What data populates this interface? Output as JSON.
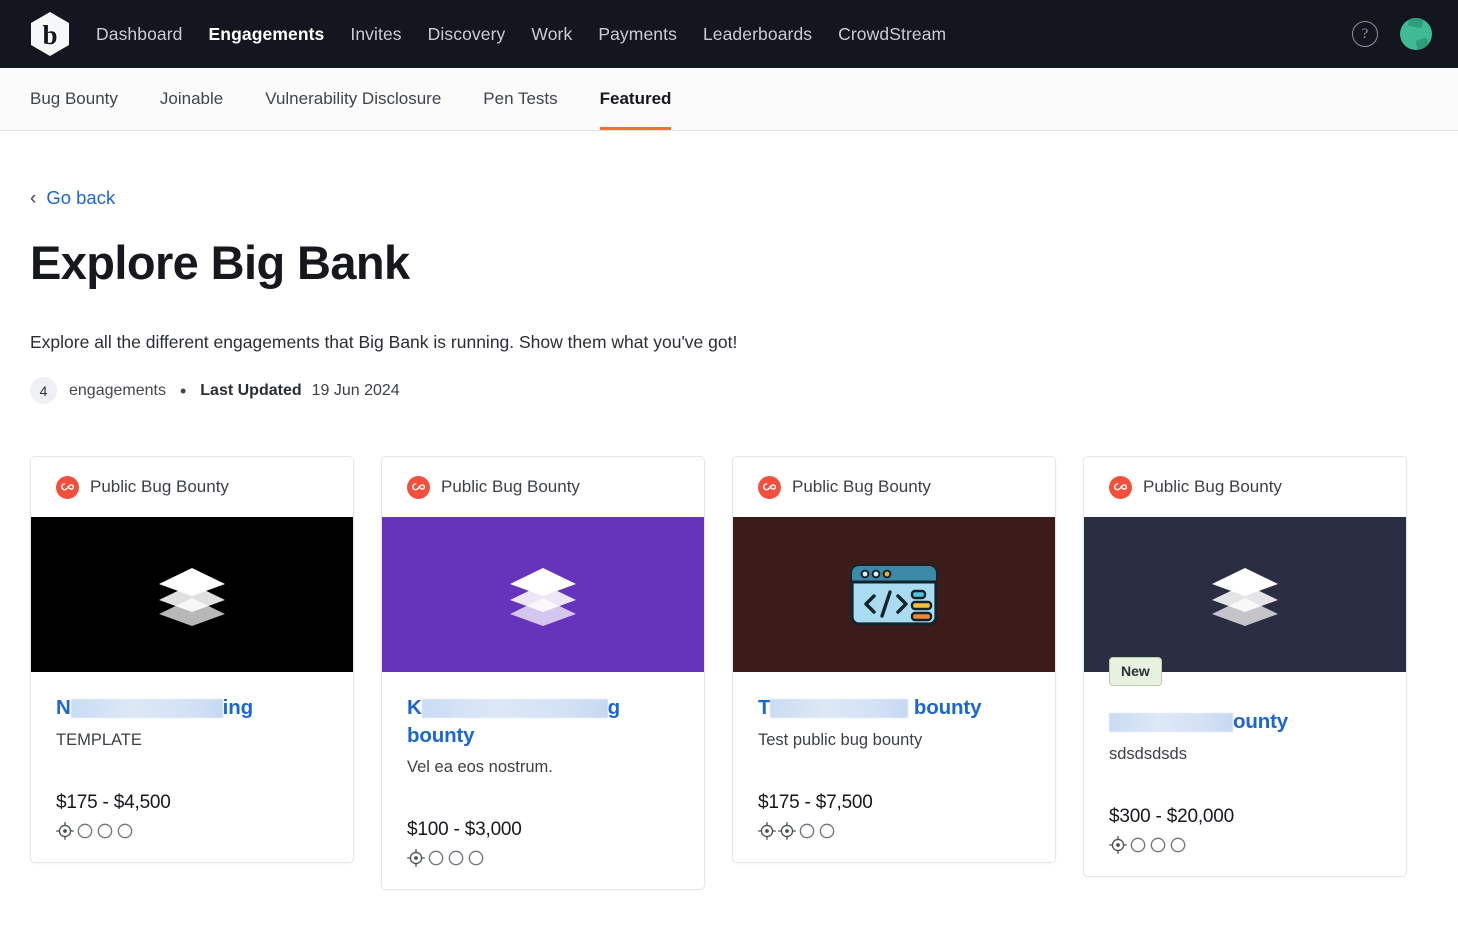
{
  "topnav": {
    "logo_alt": "bugcrowd-logo",
    "links": [
      {
        "label": "Dashboard",
        "active": false
      },
      {
        "label": "Engagements",
        "active": true
      },
      {
        "label": "Invites",
        "active": false
      },
      {
        "label": "Discovery",
        "active": false
      },
      {
        "label": "Work",
        "active": false
      },
      {
        "label": "Payments",
        "active": false
      },
      {
        "label": "Leaderboards",
        "active": false
      },
      {
        "label": "CrowdStream",
        "active": false
      }
    ],
    "help_glyph": "?",
    "avatar_alt": "user-avatar"
  },
  "subnav": {
    "tabs": [
      {
        "label": "Bug Bounty",
        "active": false
      },
      {
        "label": "Joinable",
        "active": false
      },
      {
        "label": "Vulnerability Disclosure",
        "active": false
      },
      {
        "label": "Pen Tests",
        "active": false
      },
      {
        "label": "Featured",
        "active": true
      }
    ],
    "accent_color": "#f2722b"
  },
  "page": {
    "go_back_label": "Go back",
    "go_back_chevron": "‹",
    "title": "Explore Big Bank",
    "description": "Explore all the different engagements that Big Bank is running. Show them what you've got!",
    "engagements_count": "4",
    "engagements_label": "engagements",
    "separator_dot": "•",
    "last_updated_label": "Last Updated",
    "last_updated_date": "19 Jun 2024",
    "link_color": "#1c66d4"
  },
  "cards": [
    {
      "type_label": "Public Bug Bounty",
      "hero_color": "#000000",
      "hero_icon": "stacked-layers-icon",
      "badge": null,
      "title_prefix": "N",
      "title_redacted_width": 152,
      "title_suffix": "ing",
      "subtitle": "TEMPLATE",
      "price": "$175 - $4,500",
      "rating_filled": 1,
      "rating_total": 4
    },
    {
      "type_label": "Public Bug Bounty",
      "hero_color": "#6633bb",
      "hero_icon": "stacked-layers-icon",
      "badge": null,
      "title_prefix": "K",
      "title_redacted_width": 186,
      "title_suffix": "g bounty",
      "subtitle": "Vel ea eos nostrum.",
      "price": "$100 - $3,000",
      "rating_filled": 1,
      "rating_total": 4
    },
    {
      "type_label": "Public Bug Bounty",
      "hero_color": "#3b1c1a",
      "hero_icon": "code-window-icon",
      "badge": null,
      "title_prefix": "T",
      "title_redacted_width": 138,
      "title_suffix": " bounty",
      "subtitle": "Test public bug bounty",
      "price": "$175 - $7,500",
      "rating_filled": 2,
      "rating_total": 4
    },
    {
      "type_label": "Public Bug Bounty",
      "hero_color": "#2b2d42",
      "hero_icon": "stacked-layers-icon",
      "badge": "New",
      "title_prefix": "",
      "title_redacted_width": 124,
      "title_suffix": "ounty",
      "subtitle": "sdsdsdsds",
      "price": "$300 - $20,000",
      "rating_filled": 1,
      "rating_total": 4
    }
  ]
}
